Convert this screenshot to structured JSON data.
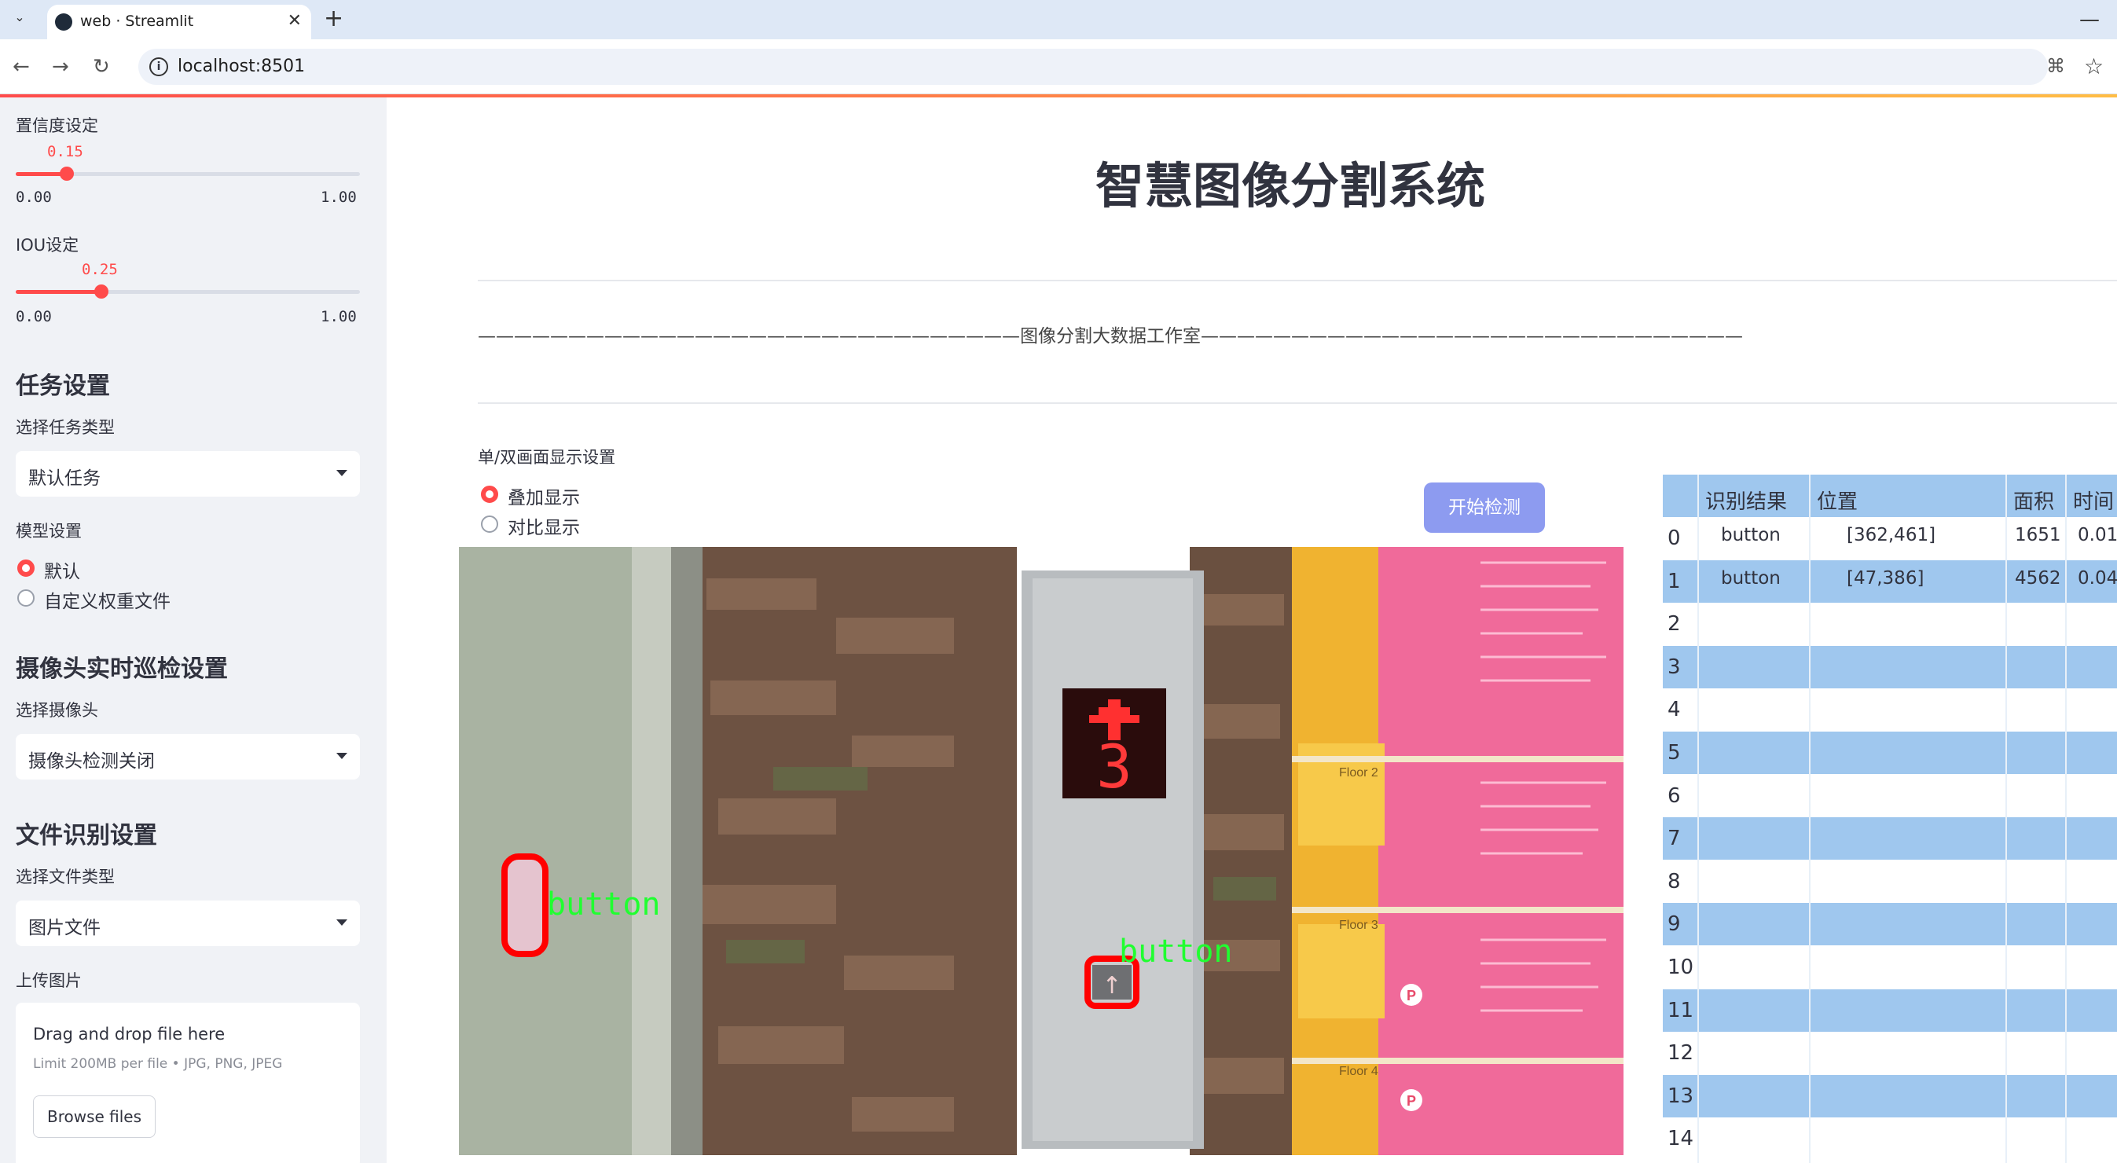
{
  "browser": {
    "tab_title": "web · Streamlit",
    "url": "localhost:8501"
  },
  "sidebar": {
    "conf": {
      "label": "置信度设定",
      "value": "0.15",
      "value_num": 0.15,
      "min": "0.00",
      "max": "1.00"
    },
    "iou": {
      "label": "IOU设定",
      "value": "0.25",
      "value_num": 0.25,
      "min": "0.00",
      "max": "1.00"
    },
    "task_heading": "任务设置",
    "task_label": "选择任务类型",
    "task_value": "默认任务",
    "model_label": "模型设置",
    "model_options": [
      "默认",
      "自定义权重文件"
    ],
    "camera_heading": "摄像头实时巡检设置",
    "camera_label": "选择摄像头",
    "camera_value": "摄像头检测关闭",
    "file_heading": "文件识别设置",
    "file_label": "选择文件类型",
    "file_value": "图片文件",
    "upload_label": "上传图片",
    "upload_title": "Drag and drop file here",
    "upload_limit": "Limit 200MB per file • JPG, PNG, JPEG",
    "browse_label": "Browse files"
  },
  "main": {
    "title": "智慧图像分割系统",
    "subtitle": "——————————————————————————————图像分割大数据工作室——————————————————————————————",
    "display_label": "单/双画面显示设置",
    "display_options": [
      "叠加显示",
      "对比显示"
    ],
    "start_button": "开始检测",
    "detections": [
      {
        "label": "button"
      },
      {
        "label": "button"
      }
    ],
    "panel_label": "Floor 2",
    "panel_label2": "Floor 3",
    "panel_label3": "Floor 4"
  },
  "table": {
    "headers": [
      "识别结果",
      "位置",
      "面积",
      "时间"
    ],
    "rows": [
      {
        "idx": "0",
        "result": "button",
        "pos": "[362,461]",
        "area": "1651",
        "time": "0.01"
      },
      {
        "idx": "1",
        "result": "button",
        "pos": "[47,386]",
        "area": "4562",
        "time": "0.04"
      },
      {
        "idx": "2"
      },
      {
        "idx": "3"
      },
      {
        "idx": "4"
      },
      {
        "idx": "5"
      },
      {
        "idx": "6"
      },
      {
        "idx": "7"
      },
      {
        "idx": "8"
      },
      {
        "idx": "9"
      },
      {
        "idx": "10"
      },
      {
        "idx": "11"
      },
      {
        "idx": "12"
      },
      {
        "idx": "13"
      },
      {
        "idx": "14"
      }
    ]
  }
}
